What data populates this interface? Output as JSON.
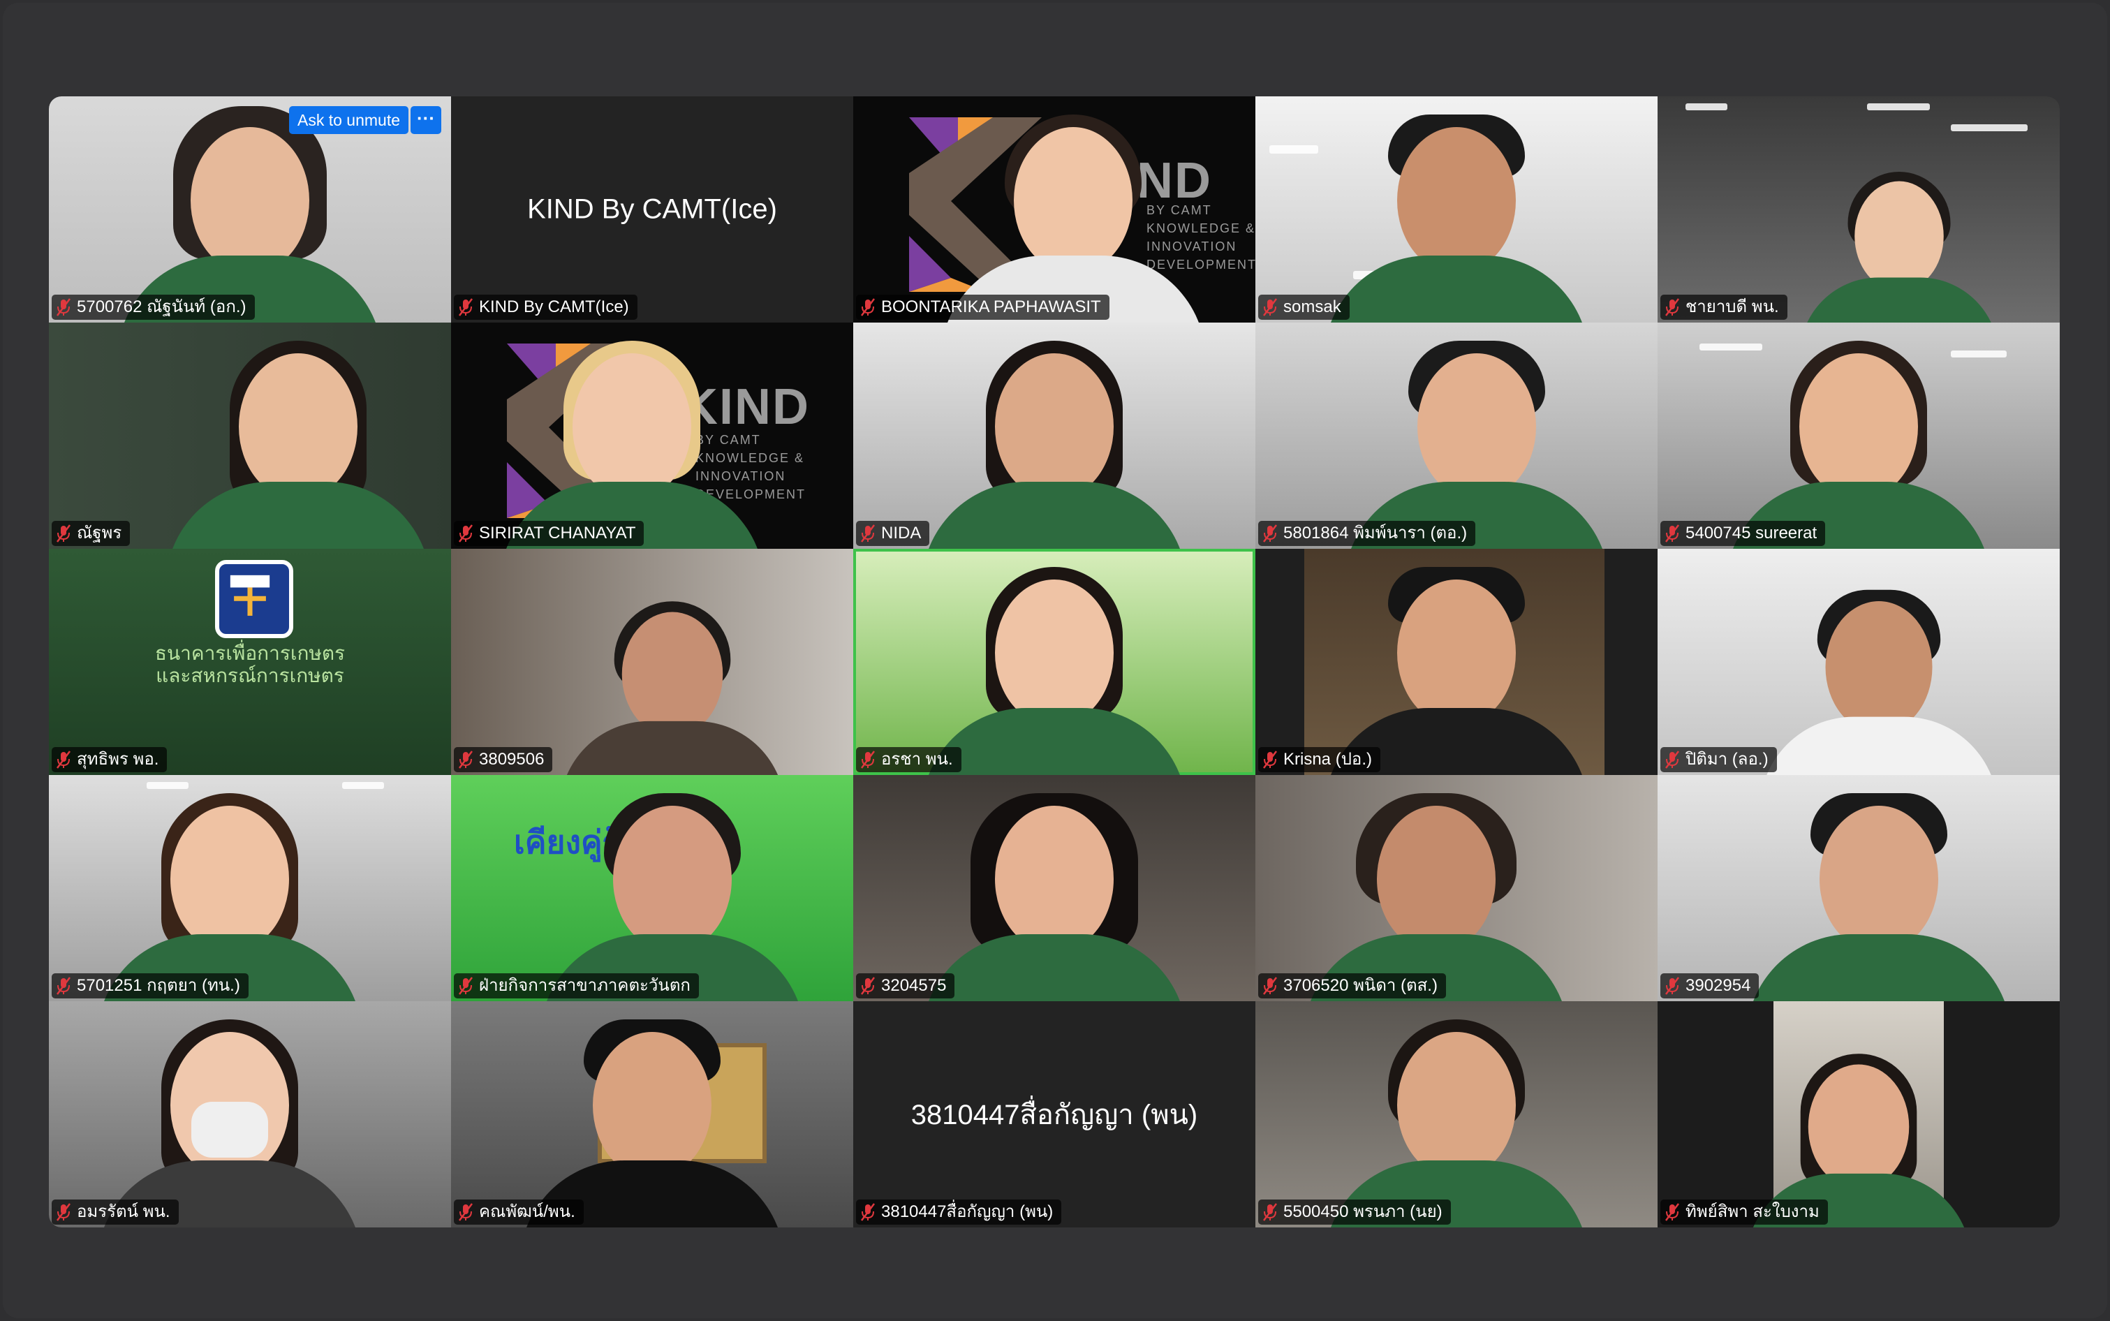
{
  "meeting": {
    "ask_to_unmute_label": "Ask to unmute",
    "more_options_label": "···",
    "active_speaker_index": 12,
    "mic_state": "muted",
    "colors": {
      "background": "#2f2f31",
      "tile_dark": "#1c1c1c",
      "unmute_button": "#0e72ed",
      "active_border": "#3ec24a",
      "muted_mic": "#e0383e"
    }
  },
  "participants": [
    {
      "name": "5700762 ณัฐนันท์ (อก.)",
      "video": true
    },
    {
      "name": "KIND By CAMT(Ice)",
      "video": false,
      "display_text": "KIND By CAMT(Ice)"
    },
    {
      "name": "BOONTARIKA PAPHAWASIT",
      "video": true,
      "logo_text": "KIND",
      "logo_sub": [
        "BY CAMT",
        "KNOWLEDGE &",
        "INNOVATION",
        "DEVELOPMENT"
      ]
    },
    {
      "name": "somsak",
      "video": true
    },
    {
      "name": "ชายาบดี พน.",
      "video": true
    },
    {
      "name": "ณัฐพร",
      "video": true
    },
    {
      "name": "SIRIRAT  CHANAYAT",
      "video": true,
      "logo_text": "KIND",
      "logo_sub": [
        "BY CAMT",
        "KNOWLEDGE &",
        "INNOVATION",
        "DEVELOPMENT"
      ]
    },
    {
      "name": "NIDA",
      "video": true
    },
    {
      "name": "5801864 พิมพ์นารา (ตอ.)",
      "video": true
    },
    {
      "name": "5400745 sureerat",
      "video": true
    },
    {
      "name": "สุทธิพร พอ.",
      "video": true,
      "bank_text": [
        "ธนาคารเพื่อการเกษตร",
        "และสหกรณ์การเกษตร"
      ]
    },
    {
      "name": "3809506",
      "video": true
    },
    {
      "name": "อรชา พน.",
      "video": true
    },
    {
      "name": "Krisna (ปอ.)",
      "video": true
    },
    {
      "name": "ปิติมา (ลอ.)",
      "video": true
    },
    {
      "name": "5701251 กฤตยา (ทน.)",
      "video": true
    },
    {
      "name": "ฝ่ายกิจการสาขาภาคตะวันตก",
      "video": true,
      "wall_sign": "เคียงคู่รู้...ชาชน"
    },
    {
      "name": "3204575",
      "video": true
    },
    {
      "name": "3706520 พนิดา (ตส.)",
      "video": true
    },
    {
      "name": "3902954",
      "video": true
    },
    {
      "name": "อมรรัตน์ พน.",
      "video": true
    },
    {
      "name": "คณพัฒน์/พน.",
      "video": true
    },
    {
      "name": "3810447สื่อกัญญา (พน)",
      "video": false,
      "display_text": "3810447สื่อกัญญา (พน)"
    },
    {
      "name": "5500450 พรนภา (นย)",
      "video": true
    },
    {
      "name": "ทิพย์สิพา สะใบงาม",
      "video": true
    }
  ]
}
